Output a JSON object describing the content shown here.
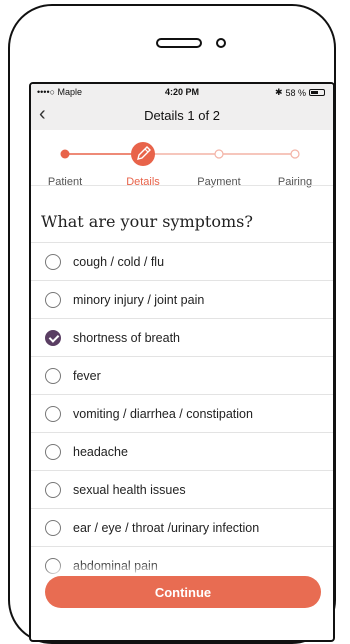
{
  "status": {
    "carrier": "••••○ Maple",
    "time": "4:20 PM",
    "battery": "58 %"
  },
  "nav": {
    "back_icon": "chevron-left-icon",
    "title": "Details 1 of 2"
  },
  "steps": [
    {
      "label": "Patient",
      "state": "done"
    },
    {
      "label": "Details",
      "state": "active"
    },
    {
      "label": "Payment",
      "state": "pending"
    },
    {
      "label": "Pairing",
      "state": "pending"
    }
  ],
  "question": "What are your symptoms?",
  "options": [
    {
      "label": "cough / cold / flu",
      "checked": false
    },
    {
      "label": "minory injury / joint pain",
      "checked": false
    },
    {
      "label": "shortness of breath",
      "checked": true
    },
    {
      "label": "fever",
      "checked": false
    },
    {
      "label": "vomiting / diarrhea / constipation",
      "checked": false
    },
    {
      "label": "headache",
      "checked": false
    },
    {
      "label": "sexual health issues",
      "checked": false
    },
    {
      "label": "ear / eye / throat /urinary infection",
      "checked": false
    },
    {
      "label": "abdominal pain",
      "checked": false
    }
  ],
  "continue_label": "Continue",
  "colors": {
    "accent": "#e8634a",
    "selected": "#5a3e63"
  }
}
